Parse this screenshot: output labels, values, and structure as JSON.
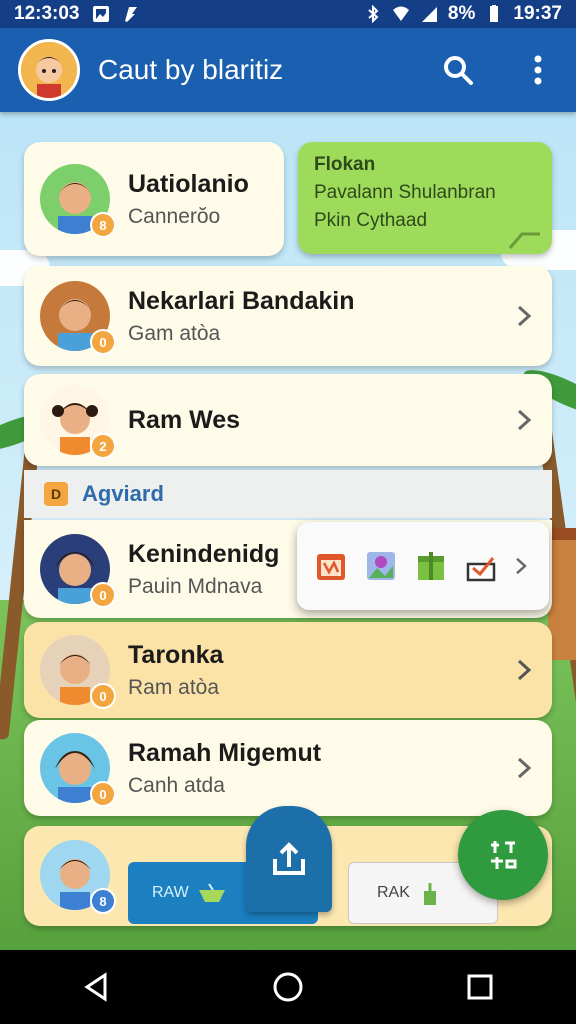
{
  "status_bar": {
    "time_left": "12:3:03",
    "battery": "8%",
    "time_right": "19:37"
  },
  "app_bar": {
    "title": "Caut by blaritiz"
  },
  "contacts": [
    {
      "name": "Uatiolanio",
      "subtitle": "Cannerŏo",
      "badge": "8"
    },
    {
      "name": "Nekarlari Bandakin",
      "subtitle": "Gam atòa",
      "badge": "0"
    },
    {
      "name": "Ram Wes",
      "subtitle": "",
      "badge": "2"
    },
    {
      "name": "Kenindenidg",
      "subtitle": "Pauin Mdnava",
      "badge": "0"
    },
    {
      "name": "Taronka",
      "subtitle": "Ram atòa",
      "badge": "0"
    },
    {
      "name": "Ramah Migemut",
      "subtitle": "Canh atda",
      "badge": "0"
    },
    {
      "name": "",
      "subtitle": "",
      "badge": "8"
    }
  ],
  "highlight_card": {
    "title": "Flokan",
    "line1": "Pavalann Shulanbran",
    "line2": "Pkin Cythaad"
  },
  "section": {
    "badge": "D",
    "label": "Agviard"
  },
  "bottom_actions": {
    "blue_label": "RAW",
    "white_label": "RAK"
  },
  "colors": {
    "app_bar": "#1a5fb0",
    "status_bar": "#143f86",
    "accent_green": "#9fdb5a",
    "fab_green": "#2f9a3e",
    "fab_blue": "#1d6fa9",
    "badge": "#f3a640"
  },
  "icons": {
    "search": "search-icon",
    "more": "more-vert-icon",
    "chevron": "chevron-right-icon",
    "back": "nav-back-icon",
    "home": "nav-home-icon",
    "recents": "nav-recents-icon"
  }
}
